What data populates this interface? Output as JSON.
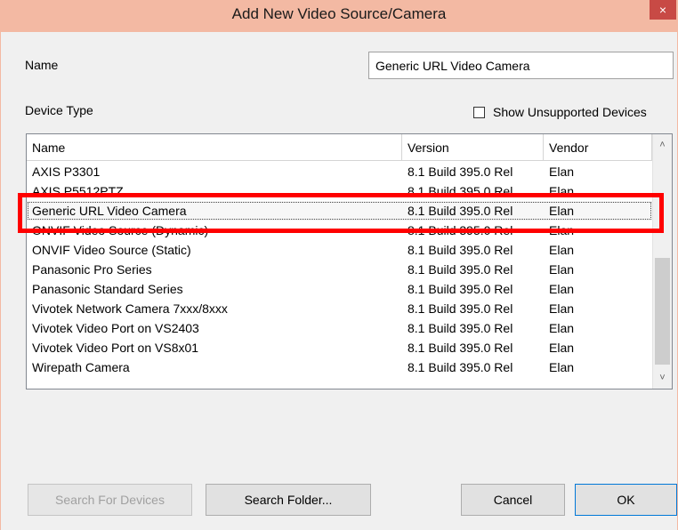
{
  "window": {
    "title": "Add New Video Source/Camera",
    "close_glyph": "×"
  },
  "form": {
    "name_label": "Name",
    "name_value": "Generic URL Video Camera",
    "device_type_label": "Device Type",
    "show_unsupported_label": "Show Unsupported Devices",
    "show_unsupported_checked": false
  },
  "table": {
    "columns": [
      "Name",
      "Version",
      "Vendor"
    ],
    "rows": [
      {
        "name": "AXIS P3301",
        "version": "8.1 Build 395.0 Rel",
        "vendor": "Elan"
      },
      {
        "name": "AXIS P5512PTZ",
        "version": "8.1 Build 395.0 Rel",
        "vendor": "Elan"
      },
      {
        "name": "Generic URL Video Camera",
        "version": "8.1 Build 395.0 Rel",
        "vendor": "Elan"
      },
      {
        "name": "ONVIF Video Source (Dynamic)",
        "version": "8.1 Build 395.0 Rel",
        "vendor": "Elan"
      },
      {
        "name": "ONVIF Video Source (Static)",
        "version": "8.1 Build 395.0 Rel",
        "vendor": "Elan"
      },
      {
        "name": "Panasonic Pro Series",
        "version": "8.1 Build 395.0 Rel",
        "vendor": "Elan"
      },
      {
        "name": "Panasonic Standard Series",
        "version": "8.1 Build 395.0 Rel",
        "vendor": "Elan"
      },
      {
        "name": "Vivotek Network Camera 7xxx/8xxx",
        "version": "8.1 Build 395.0 Rel",
        "vendor": "Elan"
      },
      {
        "name": "Vivotek Video Port on VS2403",
        "version": "8.1 Build 395.0 Rel",
        "vendor": "Elan"
      },
      {
        "name": "Vivotek Video Port on VS8x01",
        "version": "8.1 Build 395.0 Rel",
        "vendor": "Elan"
      },
      {
        "name": "Wirepath Camera",
        "version": "8.1 Build 395.0 Rel",
        "vendor": "Elan"
      }
    ],
    "selected_row_index": 2
  },
  "scrollbar": {
    "up_glyph": "˄",
    "down_glyph": "˅"
  },
  "buttons": {
    "search_devices": "Search For Devices",
    "search_folder": "Search Folder...",
    "cancel": "Cancel",
    "ok": "OK"
  },
  "colors": {
    "titlebar": "#f3b9a3",
    "close_button": "#c84a45",
    "highlight_box": "#ff0000"
  }
}
